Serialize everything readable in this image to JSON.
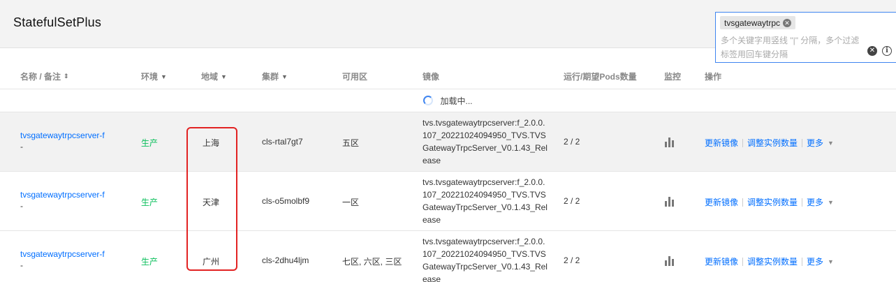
{
  "page": {
    "title": "StatefulSetPlus"
  },
  "search": {
    "tag": "tvsgatewaytrpc",
    "placeholder": "多个关键字用竖线 \"|\" 分隔，多个过滤标签用回车键分隔",
    "tag_close_icon": "close-circle-icon",
    "clear_icon": "close-circle-icon",
    "info_icon": "info-icon"
  },
  "table": {
    "columns": [
      {
        "label": "名称 / 备注",
        "icon": "sort-icon"
      },
      {
        "label": "环境",
        "icon": "filter-icon"
      },
      {
        "label": "地域",
        "icon": "filter-icon"
      },
      {
        "label": "集群",
        "icon": "filter-icon"
      },
      {
        "label": "可用区"
      },
      {
        "label": "镜像"
      },
      {
        "label": "运行/期望Pods数量"
      },
      {
        "label": "监控"
      },
      {
        "label": "操作"
      }
    ],
    "loading_text": "加载中...",
    "rows": [
      {
        "name": "tvsgatewaytrpcserver-f",
        "note": "-",
        "env": "生产",
        "region": "上海",
        "cluster": "cls-rtal7gt7",
        "zone": "五区",
        "image": "tvs.tvsgatewaytrpcserver:f_2.0.0.107_20221024094950_TVS.TVSGatewayTrpcServer_V0.1.43_Release",
        "pods": "2 / 2",
        "ops": [
          "更新镜像",
          "调整实例数量",
          "更多"
        ]
      },
      {
        "name": "tvsgatewaytrpcserver-f",
        "note": "-",
        "env": "生产",
        "region": "天津",
        "cluster": "cls-o5molbf9",
        "zone": "一区",
        "image": "tvs.tvsgatewaytrpcserver:f_2.0.0.107_20221024094950_TVS.TVSGatewayTrpcServer_V0.1.43_Release",
        "pods": "2 / 2",
        "ops": [
          "更新镜像",
          "调整实例数量",
          "更多"
        ]
      },
      {
        "name": "tvsgatewaytrpcserver-f",
        "note": "-",
        "env": "生产",
        "region": "广州",
        "cluster": "cls-2dhu4ljm",
        "zone": "七区, 六区, 三区",
        "image": "tvs.tvsgatewaytrpcserver:f_2.0.0.107_20221024094950_TVS.TVSGatewayTrpcServer_V0.1.43_Release",
        "pods": "2 / 2",
        "ops": [
          "更新镜像",
          "调整实例数量",
          "更多"
        ]
      }
    ]
  },
  "colors": {
    "link": "#006eff",
    "env": "#0abf5b",
    "highlight_box": "#e22222",
    "focus": "#3f85f0"
  }
}
